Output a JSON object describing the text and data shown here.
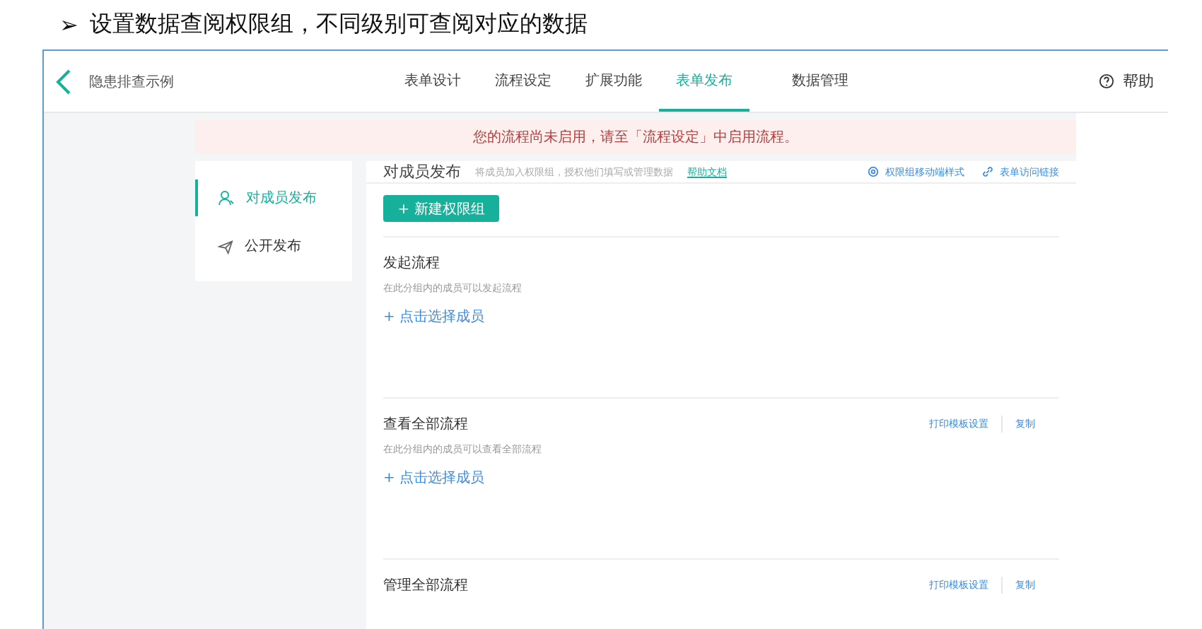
{
  "heading": {
    "bullet": "➢",
    "text": "设置数据查阅权限组，不同级别可查阅对应的数据"
  },
  "header": {
    "app_name": "隐患排查示例",
    "help": "帮助"
  },
  "tabs": [
    {
      "label": "表单设计",
      "selected": false
    },
    {
      "label": "流程设定",
      "selected": false
    },
    {
      "label": "扩展功能",
      "selected": false
    },
    {
      "label": "表单发布",
      "selected": true
    },
    {
      "label": "数据管理",
      "selected": false
    }
  ],
  "banner": "您的流程尚未启用，请至「流程设定」中启用流程。",
  "sidebar": {
    "items": [
      {
        "label": "对成员发布",
        "selected": true
      },
      {
        "label": "公开发布",
        "selected": false
      }
    ]
  },
  "panel": {
    "title": "对成员发布",
    "hint": "将成员加入权限组，授权他们填写或管理数据",
    "help_link": "帮助文档",
    "actions": [
      "权限组移动端样式",
      "表单访问链接"
    ],
    "new_button": "+ 新建权限组"
  },
  "groups": [
    {
      "title": "发起流程",
      "description": "在此分组内的成员可以发起流程",
      "add": "+ 点击选择成员"
    },
    {
      "title": "查看全部流程",
      "description": "在此分组内的成员可以查看全部流程",
      "add": "+ 点击选择成员",
      "actions": [
        "打印模板设置",
        "复制"
      ]
    },
    {
      "title": "管理全部流程",
      "actions": [
        "打印模板设置",
        "复制"
      ]
    }
  ]
}
